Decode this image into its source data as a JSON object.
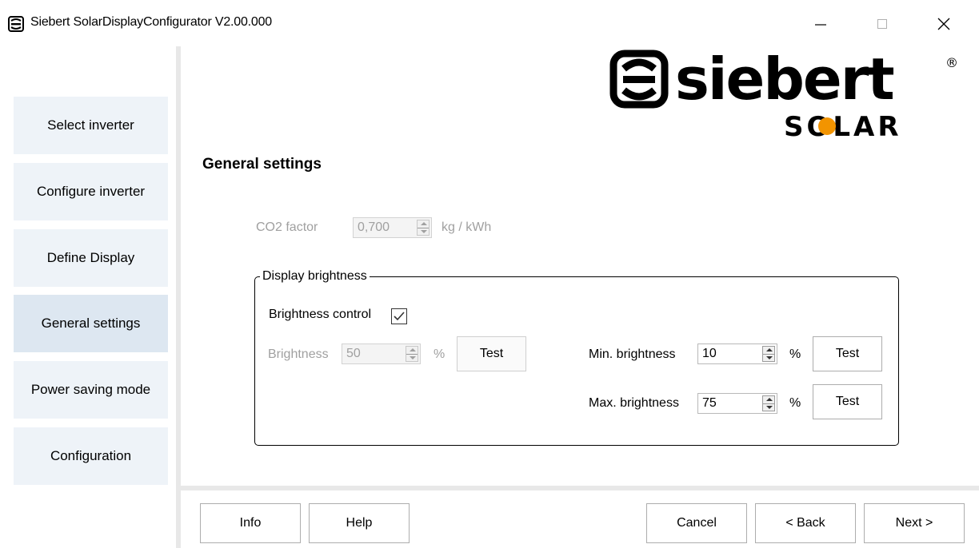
{
  "window": {
    "title": "Siebert SolarDisplayConfigurator V2.00.000",
    "controls": [
      "minimize",
      "maximize",
      "close"
    ]
  },
  "sidebar": {
    "items": [
      {
        "label": "Select inverter",
        "active": false
      },
      {
        "label": "Configure inverter",
        "active": false
      },
      {
        "label": "Define Display",
        "active": false
      },
      {
        "label": "General settings",
        "active": true
      },
      {
        "label": "Power saving mode",
        "active": false
      },
      {
        "label": "Configuration",
        "active": false
      }
    ]
  },
  "logo": {
    "brand": "siebert",
    "registered": "®",
    "sub": "SOLAR"
  },
  "main": {
    "section_title": "General settings",
    "co2": {
      "label": "CO2 factor",
      "value": "0,700",
      "unit": "kg / kWh",
      "enabled": false
    },
    "brightness_group": {
      "legend": "Display brightness",
      "control_label": "Brightness control",
      "control_checked": true,
      "brightness": {
        "label": "Brightness",
        "value": "50",
        "unit": "%",
        "enabled": false,
        "test_label": "Test"
      },
      "min": {
        "label": "Min. brightness",
        "value": "10",
        "unit": "%",
        "test_label": "Test"
      },
      "max": {
        "label": "Max. brightness",
        "value": "75",
        "unit": "%",
        "test_label": "Test"
      }
    }
  },
  "footer": {
    "info_label": "Info",
    "help_label": "Help",
    "cancel_label": "Cancel",
    "back_label": "< Back",
    "next_label": "Next >"
  },
  "colors": {
    "nav_bg": "#eef3f8",
    "nav_active_bg": "#dde7f1",
    "disabled_text": "#a0a0a0",
    "logo_black": "#000000",
    "logo_orange": "#f29400"
  }
}
